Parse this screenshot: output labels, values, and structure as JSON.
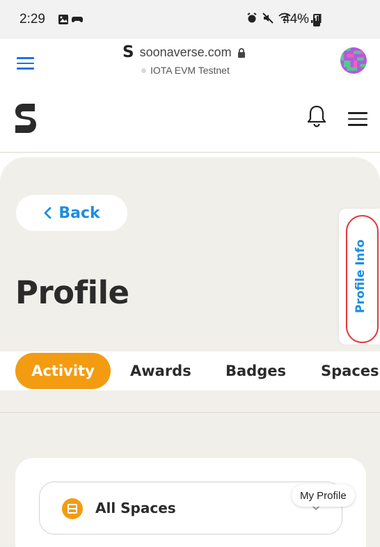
{
  "status_bar": {
    "time": "2:29",
    "network_type": "4G",
    "battery": "44%"
  },
  "browser": {
    "domain": "soonaverse.com",
    "network": "IOTA EVM Testnet"
  },
  "header": {
    "logo_letter": "S"
  },
  "main": {
    "back_label": "Back",
    "title": "Profile",
    "tabs": [
      {
        "label": "Activity",
        "active": true
      },
      {
        "label": "Awards",
        "active": false
      },
      {
        "label": "Badges",
        "active": false
      },
      {
        "label": "Spaces",
        "active": false
      }
    ],
    "space_filter": {
      "selected": "All Spaces"
    }
  },
  "side_tab": {
    "label": "Profile Info"
  },
  "tooltip": {
    "text": "My Profile"
  },
  "colors": {
    "accent_orange": "#f39c12",
    "link_blue": "#1c8de0",
    "page_bg": "#f1efe9",
    "highlight_red": "#e0393b"
  }
}
